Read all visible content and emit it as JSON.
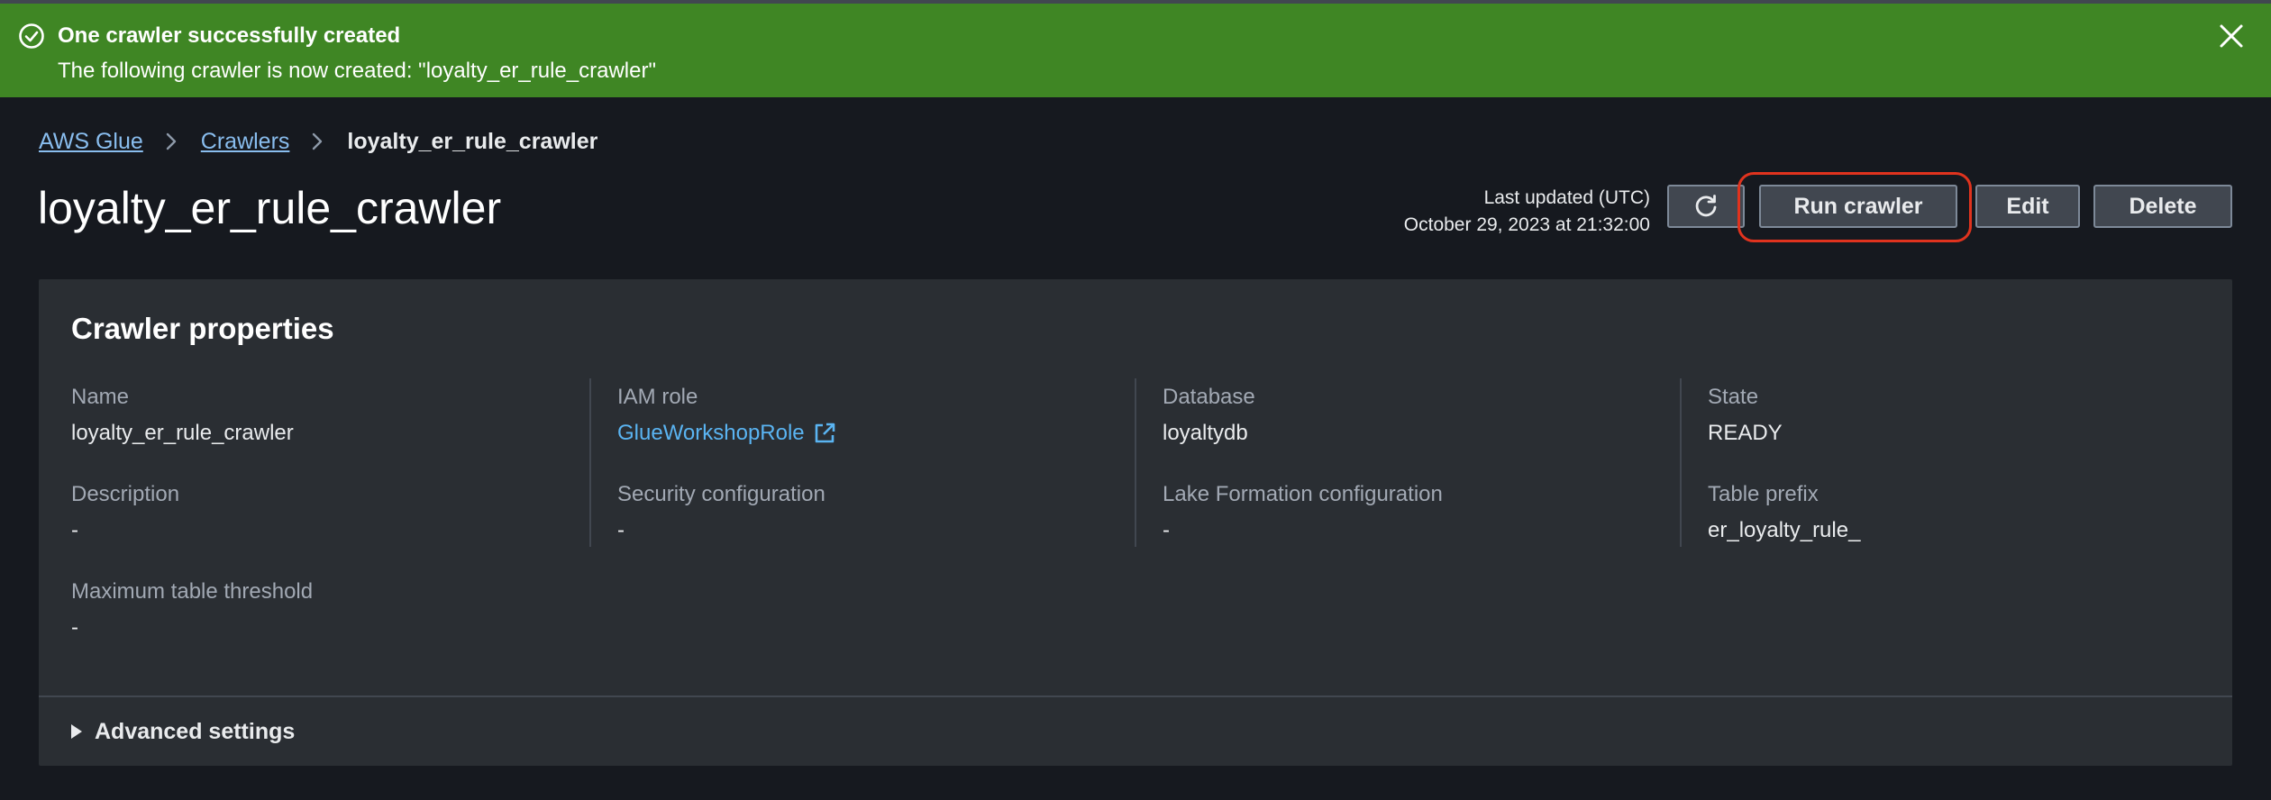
{
  "flash": {
    "title": "One crawler successfully created",
    "message": "The following crawler is now created: \"loyalty_er_rule_crawler\"",
    "icon": "success-circle-icon",
    "background_color": "#3f8624"
  },
  "breadcrumb": {
    "items": [
      "AWS Glue",
      "Crawlers"
    ],
    "current": "loyalty_er_rule_crawler"
  },
  "header": {
    "title": "loyalty_er_rule_crawler",
    "last_updated_label": "Last updated (UTC)",
    "last_updated_value": "October 29, 2023 at 21:32:00",
    "buttons": {
      "refresh_icon": "refresh-icon",
      "run": "Run crawler",
      "edit": "Edit",
      "delete": "Delete"
    },
    "highlight_color": "#e0331e"
  },
  "properties": {
    "title": "Crawler properties",
    "name": {
      "label": "Name",
      "value": "loyalty_er_rule_crawler"
    },
    "iam_role": {
      "label": "IAM role",
      "value": "GlueWorkshopRole"
    },
    "database": {
      "label": "Database",
      "value": "loyaltydb"
    },
    "state": {
      "label": "State",
      "value": "READY"
    },
    "description": {
      "label": "Description",
      "value": "-"
    },
    "security_configuration": {
      "label": "Security configuration",
      "value": "-"
    },
    "lake_formation": {
      "label": "Lake Formation configuration",
      "value": "-"
    },
    "table_prefix": {
      "label": "Table prefix",
      "value": "er_loyalty_rule_"
    },
    "max_table_threshold": {
      "label": "Maximum table threshold",
      "value": "-"
    },
    "advanced_settings": "Advanced settings"
  }
}
